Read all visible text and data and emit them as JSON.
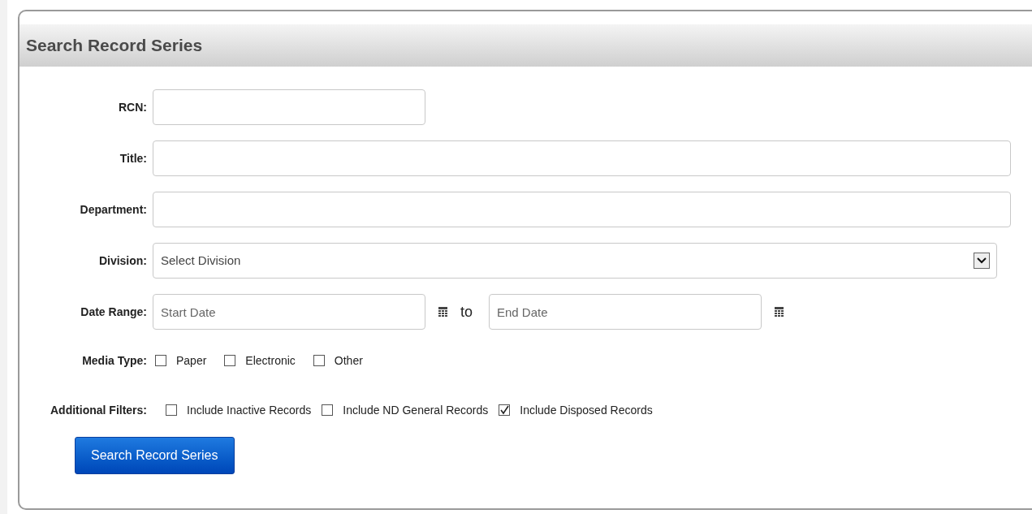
{
  "panel": {
    "title": "Search Record Series"
  },
  "fields": [
    {
      "kind": "short",
      "label": "RCN:"
    },
    {
      "kind": "text",
      "label": "Title:"
    },
    {
      "kind": "text",
      "label": "Department:"
    },
    {
      "kind": "select",
      "label": "Division:",
      "value": "Select Division"
    },
    {
      "kind": "daterange",
      "label": "Date Range:",
      "start_placeholder": "Start Date",
      "separator": "to",
      "end_placeholder": "End Date"
    },
    {
      "kind": "checkboxes",
      "label": "Media Type:",
      "options": [
        {
          "label": "Paper",
          "checked": false
        },
        {
          "label": "Electronic",
          "checked": false
        },
        {
          "label": "Other",
          "checked": false
        }
      ]
    },
    {
      "kind": "checkboxes",
      "label": "Additional Filters:",
      "options": [
        {
          "label": "Include Inactive Records",
          "checked": false
        },
        {
          "label": "Include ND General Records",
          "checked": false
        },
        {
          "label": "Include Disposed Records",
          "checked": true
        }
      ]
    }
  ],
  "buttons": [
    {
      "label": "Search Record Series"
    }
  ]
}
